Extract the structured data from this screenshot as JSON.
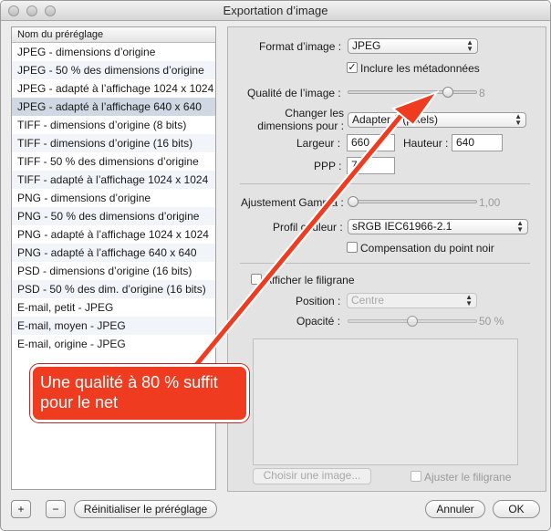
{
  "window": {
    "title": "Exportation d’image"
  },
  "presets": {
    "header": "Nom du préréglage",
    "items": [
      "JPEG - dimensions d’origine",
      "JPEG - 50 % des dimensions d’origine",
      "JPEG - adapté à l’affichage 1024 x 1024",
      "JPEG - adapté à l’affichage 640 x 640",
      "TIFF - dimensions d’origine (8 bits)",
      "TIFF - dimensions d’origine (16 bits)",
      "TIFF - 50 % des dimensions d’origine",
      "TIFF - adapté à l’affichage 1024 x 1024",
      "PNG - dimensions d’origine",
      "PNG - 50 % des dimensions d’origine",
      "PNG - adapté à l’affichage 1024 x 1024",
      "PNG - adapté à l’affichage 640 x 640",
      "PSD - dimensions d’origine (16 bits)",
      "PSD - 50 % des dim. d’origine (16 bits)",
      "E-mail, petit - JPEG",
      "E-mail, moyen - JPEG",
      "E-mail, origine - JPEG"
    ],
    "selected_index": 3
  },
  "bottom": {
    "add_label": "+",
    "remove_label": "−",
    "reset_label": "Réinitialiser le préréglage",
    "cancel_label": "Annuler",
    "ok_label": "OK"
  },
  "format": {
    "label": "Format d’image :",
    "value": "JPEG",
    "include_metadata_label": "Inclure les métadonnées",
    "include_metadata_checked": true
  },
  "quality": {
    "label": "Qualité de l’image :",
    "value_text": "8",
    "level": 0.8
  },
  "resize": {
    "label_line1": "Changer les",
    "label_line2": "dimensions pour :",
    "value": "Adapter à (pixels)",
    "width_label": "Largeur :",
    "width_value": "660",
    "height_label": "Hauteur :",
    "height_value": "640",
    "ppp_label": "PPP :",
    "ppp_value": "72"
  },
  "gamma": {
    "label": "Ajustement Gamma :",
    "value_text": "1,00",
    "level": 0.0
  },
  "profile": {
    "label": "Profil couleur :",
    "value": "sRGB IEC61966-2.1",
    "black_point_label": "Compensation du point noir",
    "black_point_checked": false
  },
  "watermark": {
    "show_label": "Afficher le filigrane",
    "show_checked": false,
    "position_label": "Position :",
    "position_value": "Centre",
    "opacity_label": "Opacité :",
    "opacity_value_text": "50 %",
    "opacity_level": 0.5,
    "choose_label": "Choisir une image...",
    "adjust_label": "Ajuster le filigrane",
    "adjust_checked": false
  },
  "annotation": {
    "line1": "Une qualité à 80 % suffit",
    "line2": "pour le net",
    "color": "#ef3b1f"
  }
}
